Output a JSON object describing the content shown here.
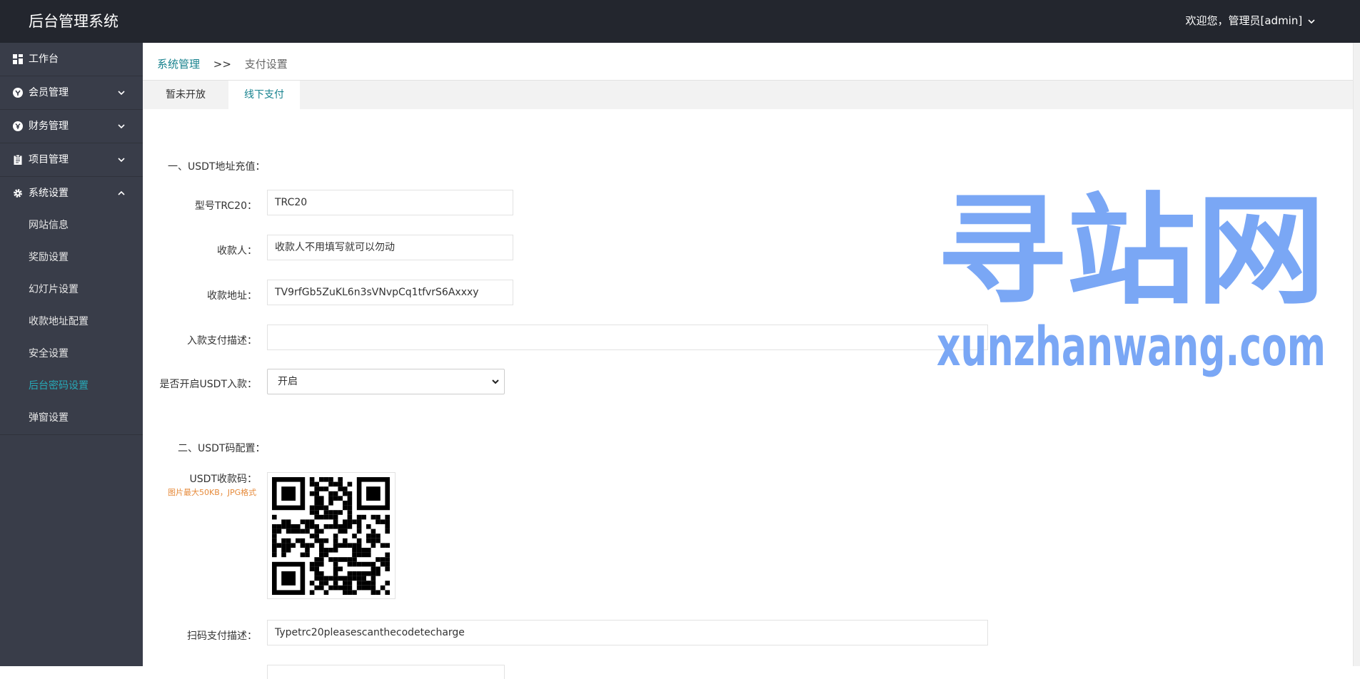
{
  "header": {
    "brand": "后台管理系统",
    "user_greeting": "欢迎您，管理员[admin]"
  },
  "sidebar": {
    "items": [
      {
        "label": "工作台",
        "icon": "dashboard-icon"
      },
      {
        "label": "会员管理",
        "icon": "member-icon"
      },
      {
        "label": "财务管理",
        "icon": "yen-icon"
      },
      {
        "label": "项目管理",
        "icon": "clipboard-icon"
      },
      {
        "label": "系统设置",
        "icon": "gear-icon"
      }
    ],
    "sub_items": [
      {
        "label": "网站信息"
      },
      {
        "label": "奖励设置"
      },
      {
        "label": "幻灯片设置"
      },
      {
        "label": "收款地址配置"
      },
      {
        "label": "安全设置"
      },
      {
        "label": "后台密码设置",
        "active": true
      },
      {
        "label": "弹窗设置"
      }
    ]
  },
  "breadcrumb": {
    "parent": "系统管理",
    "separator": ">>",
    "current": "支付设置"
  },
  "tabs": [
    {
      "label": "暂未开放"
    },
    {
      "label": "线下支付",
      "active": true
    }
  ],
  "form": {
    "section1_title": "一、USDT地址充值：",
    "model_label": "型号TRC20：",
    "model_value": "TRC20",
    "payee_label": "收款人：",
    "payee_value": "收款人不用填写就可以勿动",
    "address_label": "收款地址：",
    "address_value": "TV9rfGb5ZuKL6n3sVNvpCq1tfvrS6Axxxy",
    "deposit_desc_label": "入款支付描述：",
    "deposit_desc_value": "",
    "enable_label": "是否开启USDT入款：",
    "enable_value": "开启",
    "section2_title": "二、USDT码配置：",
    "qr_label": "USDT收款码：",
    "qr_hint": "图片最大50KB，JPG格式",
    "scan_desc_label": "扫码支付描述：",
    "scan_desc_value": "Typetrc20pleasescanthecodetecharge"
  },
  "watermark": {
    "title": "寻站网",
    "url": "xunzhanwang.com"
  },
  "colors": {
    "topbar": "#23262e",
    "sidebar": "#393d49",
    "accent": "#17828e",
    "active_sub": "#27a9b8",
    "watermark": "#7aa7f5"
  }
}
